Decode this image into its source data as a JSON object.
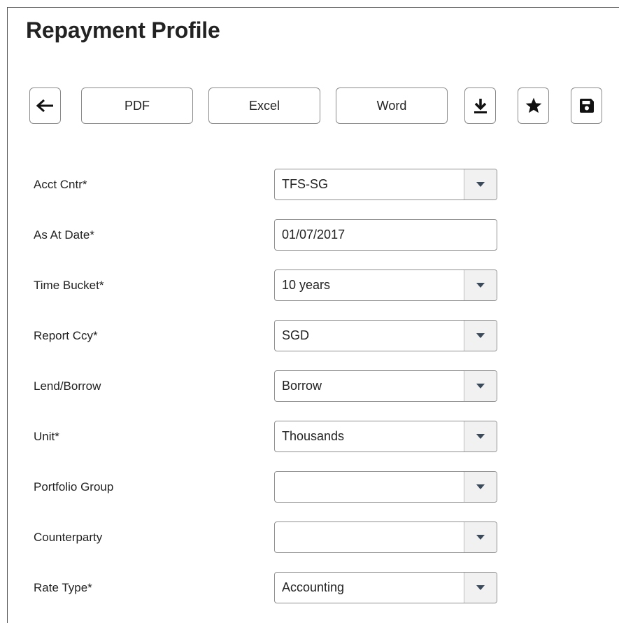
{
  "page": {
    "title": "Repayment Profile"
  },
  "toolbar": {
    "back_icon": "arrow-left-icon",
    "pdf_label": "PDF",
    "excel_label": "Excel",
    "word_label": "Word",
    "download_icon": "download-icon",
    "favorite_icon": "star-icon",
    "save_icon": "floppy-disk-icon"
  },
  "form": {
    "acct_cntr": {
      "label": "Acct Cntr*",
      "value": "TFS-SG"
    },
    "as_at_date": {
      "label": "As At Date*",
      "value": "01/07/2017"
    },
    "time_bucket": {
      "label": "Time Bucket*",
      "value": "10 years"
    },
    "report_ccy": {
      "label": "Report Ccy*",
      "value": "SGD"
    },
    "lend_borrow": {
      "label": "Lend/Borrow",
      "value": "Borrow"
    },
    "unit": {
      "label": "Unit*",
      "value": "Thousands"
    },
    "portfolio_group": {
      "label": "Portfolio Group",
      "value": ""
    },
    "counterparty": {
      "label": "Counterparty",
      "value": ""
    },
    "rate_type": {
      "label": "Rate Type*",
      "value": "Accounting"
    }
  },
  "icons": {
    "dropdown_caret": "caret-down-icon"
  }
}
